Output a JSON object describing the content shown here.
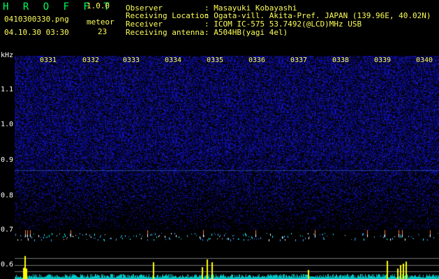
{
  "app": {
    "name": "H R O F F T",
    "version": "1.0.0"
  },
  "file": {
    "name": "0410300330.png",
    "datetime": "04.10.30 03:30"
  },
  "meteor": {
    "label": "meteor",
    "count": "23"
  },
  "info": {
    "observer_label": "Observer",
    "observer_value": ": Masayuki Kobayashi",
    "location_label": "Receiving Location",
    "location_value": ": Ogata-vill. Akita-Pref. JAPAN (139.96E, 40.02N)",
    "receiver_label": "Receiver",
    "receiver_value": ": ICOM IC-575 53.7492(@LCD)MHz USB",
    "antenna_label": "Receiving antenna",
    "antenna_value": ": A504HB(yagi 4el)"
  },
  "axis": {
    "unit": "kHz",
    "y_ticks": [
      "1.1",
      "1.0",
      "0.9",
      "0.8",
      "0.7",
      "0.6"
    ],
    "time_ticks": [
      "0331",
      "0332",
      "0333",
      "0334",
      "0335",
      "0336",
      "0337",
      "0338",
      "0339",
      "0340"
    ]
  },
  "colors": {
    "title": "#00ff5a",
    "labels": "#ffff5a",
    "background_noise": "#1a1a8c",
    "signal_band": "#00ffff",
    "meteor_peak": "#ffff00"
  }
}
